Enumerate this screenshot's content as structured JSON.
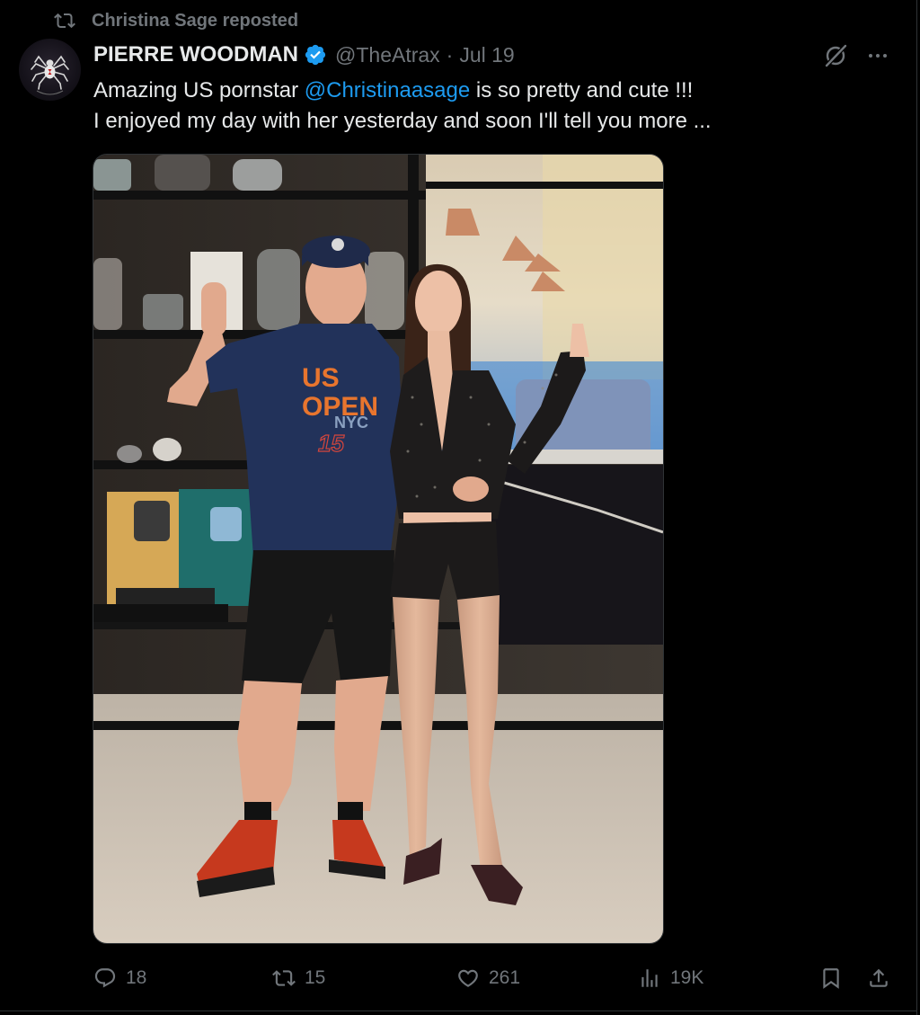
{
  "repost": {
    "icon": "repost-icon",
    "label": "Christina Sage reposted"
  },
  "author": {
    "display_name": "PIERRE WOODMAN",
    "verified_icon": "verified-badge-icon",
    "handle": "@TheAtrax",
    "separator": "·",
    "date": "Jul 19"
  },
  "tweet": {
    "line1_before": "Amazing US pornstar ",
    "line1_mention": "@Christinaasage",
    "line1_after": " is so pretty and cute !!!",
    "line2": "I enjoyed my day with her yesterday and soon I'll tell you more ..."
  },
  "media": {
    "shirt_text": {
      "top": "US",
      "middle": "OPEN",
      "bottom": "NYC",
      "number": "15"
    }
  },
  "actions": {
    "replies": "18",
    "reposts": "15",
    "likes": "261",
    "views": "19K"
  },
  "colors": {
    "background": "#000000",
    "text_primary": "#e7e9ea",
    "text_secondary": "#71767b",
    "accent": "#1d9bf0",
    "border": "#2f3336"
  }
}
